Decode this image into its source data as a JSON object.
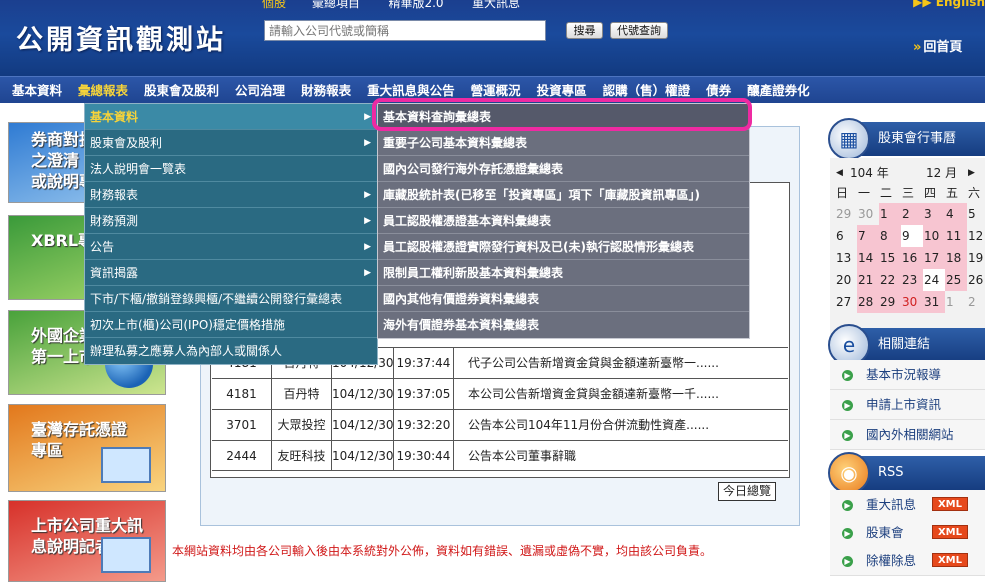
{
  "header": {
    "logo": "公開資訊觀測站",
    "top_tabs": [
      "個股",
      "彙總項目",
      "精華版2.0",
      "重大訊息"
    ],
    "english": "▶▶ English",
    "search_placeholder": "請輸入公司代號或簡稱",
    "search_button": "搜尋",
    "code_lookup_button": "代號查詢",
    "home_link": "回首頁"
  },
  "nav": {
    "items": [
      "基本資料",
      "彙總報表",
      "股東會及股利",
      "公司治理",
      "財務報表",
      "重大訊息與公告",
      "營運概況",
      "投資專區",
      "認購（售）權證",
      "債券",
      "釀產證券化"
    ],
    "active_index": 1
  },
  "menu_level1": {
    "items": [
      {
        "label": "基本資料",
        "has_sub": true
      },
      {
        "label": "股東會及股利",
        "has_sub": true
      },
      {
        "label": "法人說明會一覽表",
        "has_sub": false
      },
      {
        "label": "財務報表",
        "has_sub": true
      },
      {
        "label": "財務預測",
        "has_sub": true
      },
      {
        "label": "公告",
        "has_sub": true
      },
      {
        "label": "資訊揭露",
        "has_sub": true
      },
      {
        "label": "下市/下櫃/撤銷登錄興櫃/不繼續公開發行彙總表",
        "has_sub": false
      },
      {
        "label": "初次上市(櫃)公司(IPO)穩定價格措施",
        "has_sub": false
      },
      {
        "label": "辦理私募之應募人為內部人或關係人",
        "has_sub": false
      }
    ],
    "active_index": 0,
    "sub_arrow": "▶"
  },
  "menu_level2": {
    "items": [
      "基本資料查詢彙總表",
      "重要子公司基本資料彙總表",
      "國內公司發行海外存託憑證彙總表",
      "庫藏股統計表(已移至「投資專區」項下「庫藏股資訊專區」)",
      "員工認股權憑證基本資料彙總表",
      "員工認股權憑證實際發行資料及已(未)執行認股情形彙總表",
      "限制員工權利新股基本資料彙總表",
      "國內其他有價證券資料彙總表",
      "海外有價證券基本資料彙總表"
    ],
    "highlighted_index": 0,
    "highlight_color": "#ee2aa2"
  },
  "banners": [
    {
      "lines": [
        "券商對投",
        "之澄清",
        "或說明專區"
      ],
      "icon": "promo-icon"
    },
    {
      "lines": [
        "XBRL專區"
      ],
      "icon": "xbrl-icon"
    },
    {
      "lines": [
        "外國企業",
        "第一上市"
      ],
      "icon": "globe-icon"
    },
    {
      "lines": [
        "臺灣存託憑證",
        "專區"
      ],
      "icon": "screen-icon"
    },
    {
      "lines": [
        "上市公司重大訊",
        "息說明記者會"
      ],
      "icon": "screen-icon"
    }
  ],
  "announcements": {
    "rows": [
      {
        "code": "4181",
        "name": "百丹特",
        "date": "104/12/30",
        "time": "19:37:44",
        "subject": "代子公司公告新增資金貸與金額達新臺幣一......"
      },
      {
        "code": "4181",
        "name": "百丹特",
        "date": "104/12/30",
        "time": "19:37:05",
        "subject": "本公司公告新增資金貸與金額達新臺幣一千......"
      },
      {
        "code": "3701",
        "name": "大眾投控",
        "date": "104/12/30",
        "time": "19:32:20",
        "subject": "公告本公司104年11月份合併流動性資產......"
      },
      {
        "code": "2444",
        "name": "友旺科技",
        "date": "104/12/30",
        "time": "19:30:44",
        "subject": "公告本公司董事辭職"
      }
    ],
    "today_button": "今日總覽"
  },
  "disclaimer": "本網站資料均由各公司輸入後由本系統對外公佈，資料如有錯誤、遺漏或虛偽不實，均由該公司負責。",
  "calendar": {
    "title": "股東會行事曆",
    "year_label": "104 年",
    "month_label": "12 月",
    "prev": "◀",
    "next": "▶",
    "weekdays": [
      "日",
      "一",
      "二",
      "三",
      "四",
      "五",
      "六"
    ],
    "weeks": [
      [
        "29",
        "30",
        "1",
        "2",
        "3",
        "4",
        "5"
      ],
      [
        "6",
        "7",
        "8",
        "9",
        "10",
        "11",
        "12"
      ],
      [
        "13",
        "14",
        "15",
        "16",
        "17",
        "18",
        "19"
      ],
      [
        "20",
        "21",
        "22",
        "23",
        "24",
        "25",
        "26"
      ],
      [
        "27",
        "28",
        "29",
        "30",
        "31",
        "1",
        "2"
      ]
    ]
  },
  "related_links": {
    "title": "相關連結",
    "items": [
      "基本市況報導",
      "申請上市資訊",
      "國內外相關網站"
    ]
  },
  "rss": {
    "title": "RSS",
    "items": [
      "重大訊息",
      "股東會",
      "除權除息"
    ],
    "badge": "XML"
  }
}
